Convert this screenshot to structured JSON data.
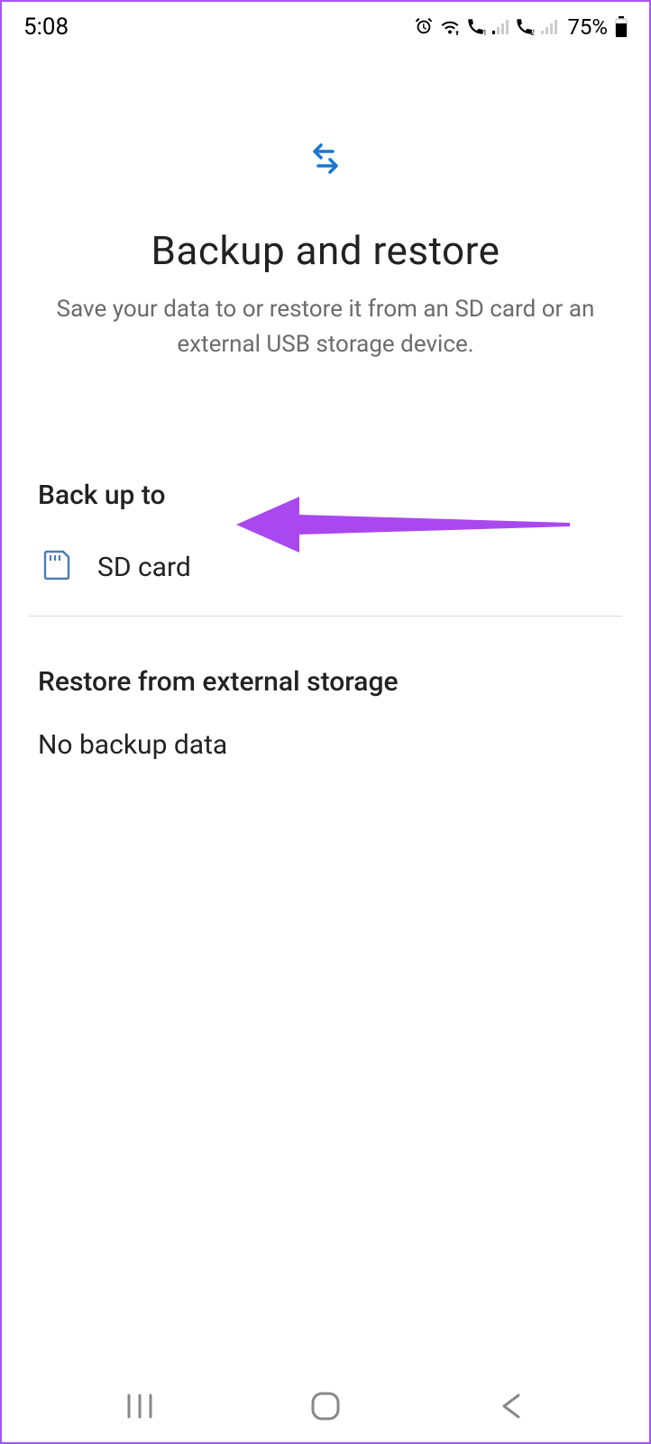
{
  "status": {
    "time": "5:08",
    "battery_pct": "75%"
  },
  "header": {
    "title": "Backup and restore",
    "subtitle": "Save your data to or restore it from an SD card or an external USB storage device."
  },
  "backup": {
    "section_title": "Back up to",
    "sd_card_label": "SD card"
  },
  "restore": {
    "section_title": "Restore from external storage",
    "no_data": "No backup data"
  },
  "colors": {
    "accent_blue": "#1976d2",
    "icon_outline": "#4a7db8",
    "annotation": "#a948ef",
    "border": "#a855f7"
  }
}
